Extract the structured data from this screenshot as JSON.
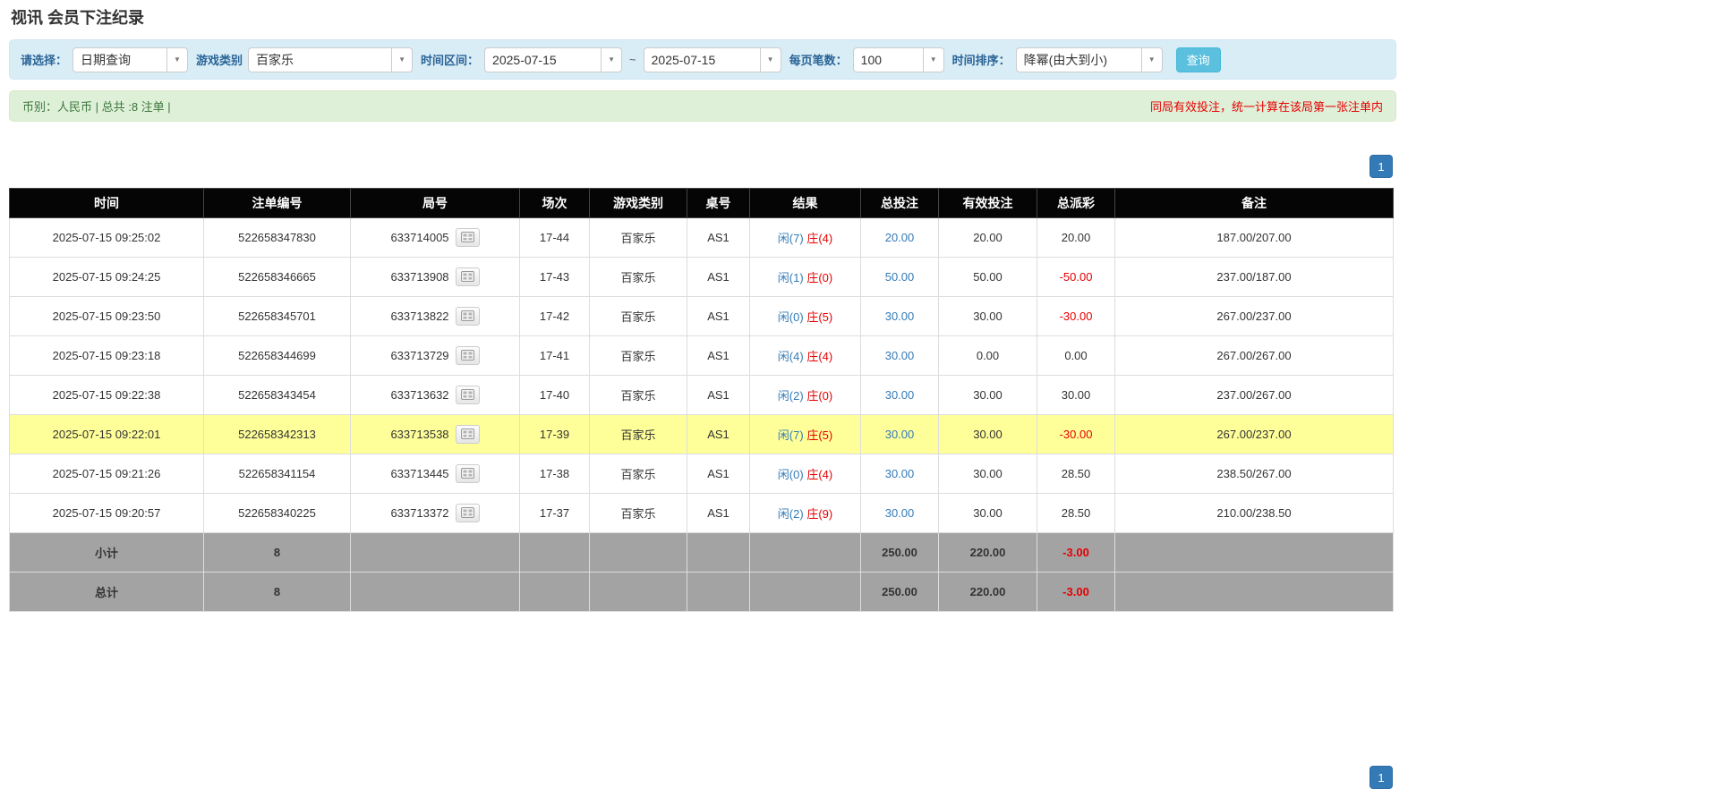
{
  "page": {
    "title": "视讯 会员下注纪录"
  },
  "icons": {
    "caret": "▼"
  },
  "colors": {
    "filter_bar_bg": "#d9edf7",
    "notice_bar_bg": "#dff0d8",
    "notice_green": "#3c763d",
    "warning_red": "#e60000",
    "link_blue": "#337ab7",
    "header_bg": "#050505",
    "highlight_yellow": "#ffff99",
    "summary_gray": "#a3a3a3",
    "search_button_bg": "#5bc0de"
  },
  "filters": {
    "select_type": {
      "label": "请选择：",
      "value": "日期查询"
    },
    "game_category": {
      "label": "游戏类别",
      "value": "百家乐"
    },
    "date_range": {
      "label": "时间区间：",
      "from": "2025-07-15",
      "separator": "~",
      "to": "2025-07-15"
    },
    "page_size": {
      "label": "每页笔数：",
      "value": "100"
    },
    "time_sort": {
      "label": "时间排序：",
      "value": "降幂(由大到小)"
    },
    "search_button": "查询"
  },
  "notice_bar": {
    "left": "币别：人民币 | 总共 :8 注单 |",
    "right": "同局有效投注，统一计算在该局第一张注单内"
  },
  "pagination": {
    "page": "1"
  },
  "table": {
    "headers": [
      "时间",
      "注单编号",
      "局号",
      "场次",
      "游戏类别",
      "桌号",
      "结果",
      "总投注",
      "有效投注",
      "总派彩",
      "备注"
    ],
    "rows": [
      {
        "time": "2025-07-15 09:25:02",
        "bet_id": "522658347830",
        "round_id": "633714005",
        "session": "17-44",
        "game": "百家乐",
        "table_no": "AS1",
        "result_player": "闲(7)",
        "result_banker": "庄(4)",
        "total_bet": "20.00",
        "valid_bet": "20.00",
        "payout": "20.00",
        "remark": "187.00/207.00",
        "highlighted": false
      },
      {
        "time": "2025-07-15 09:24:25",
        "bet_id": "522658346665",
        "round_id": "633713908",
        "session": "17-43",
        "game": "百家乐",
        "table_no": "AS1",
        "result_player": "闲(1)",
        "result_banker": "庄(0)",
        "total_bet": "50.00",
        "valid_bet": "50.00",
        "payout": "-50.00",
        "remark": "237.00/187.00",
        "highlighted": false
      },
      {
        "time": "2025-07-15 09:23:50",
        "bet_id": "522658345701",
        "round_id": "633713822",
        "session": "17-42",
        "game": "百家乐",
        "table_no": "AS1",
        "result_player": "闲(0)",
        "result_banker": "庄(5)",
        "total_bet": "30.00",
        "valid_bet": "30.00",
        "payout": "-30.00",
        "remark": "267.00/237.00",
        "highlighted": false
      },
      {
        "time": "2025-07-15 09:23:18",
        "bet_id": "522658344699",
        "round_id": "633713729",
        "session": "17-41",
        "game": "百家乐",
        "table_no": "AS1",
        "result_player": "闲(4)",
        "result_banker": "庄(4)",
        "total_bet": "30.00",
        "valid_bet": "0.00",
        "payout": "0.00",
        "remark": "267.00/267.00",
        "highlighted": false
      },
      {
        "time": "2025-07-15 09:22:38",
        "bet_id": "522658343454",
        "round_id": "633713632",
        "session": "17-40",
        "game": "百家乐",
        "table_no": "AS1",
        "result_player": "闲(2)",
        "result_banker": "庄(0)",
        "total_bet": "30.00",
        "valid_bet": "30.00",
        "payout": "30.00",
        "remark": "237.00/267.00",
        "highlighted": false
      },
      {
        "time": "2025-07-15 09:22:01",
        "bet_id": "522658342313",
        "round_id": "633713538",
        "session": "17-39",
        "game": "百家乐",
        "table_no": "AS1",
        "result_player": "闲(7)",
        "result_banker": "庄(5)",
        "total_bet": "30.00",
        "valid_bet": "30.00",
        "payout": "-30.00",
        "remark": "267.00/237.00",
        "highlighted": true
      },
      {
        "time": "2025-07-15 09:21:26",
        "bet_id": "522658341154",
        "round_id": "633713445",
        "session": "17-38",
        "game": "百家乐",
        "table_no": "AS1",
        "result_player": "闲(0)",
        "result_banker": "庄(4)",
        "total_bet": "30.00",
        "valid_bet": "30.00",
        "payout": "28.50",
        "remark": "238.50/267.00",
        "highlighted": false
      },
      {
        "time": "2025-07-15 09:20:57",
        "bet_id": "522658340225",
        "round_id": "633713372",
        "session": "17-37",
        "game": "百家乐",
        "table_no": "AS1",
        "result_player": "闲(2)",
        "result_banker": "庄(9)",
        "total_bet": "30.00",
        "valid_bet": "30.00",
        "payout": "28.50",
        "remark": "210.00/238.50",
        "highlighted": false
      }
    ],
    "subtotal": {
      "label": "小计",
      "count": "8",
      "total_bet": "250.00",
      "valid_bet": "220.00",
      "payout": "-3.00"
    },
    "total": {
      "label": "总计",
      "count": "8",
      "total_bet": "250.00",
      "valid_bet": "220.00",
      "payout": "-3.00"
    }
  }
}
